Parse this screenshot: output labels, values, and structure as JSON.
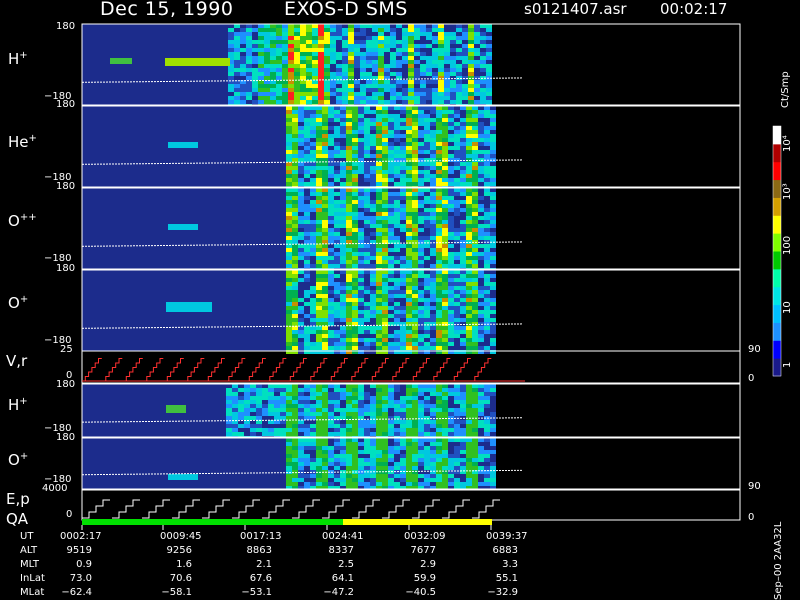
{
  "header": {
    "date": "Dec 15, 1990",
    "instrument": "EXOS-D SMS",
    "file": "s0121407.asr",
    "time": "00:02:17"
  },
  "colorbar": {
    "unit": "Ct/Smp",
    "ticks": [
      "10⁴",
      "10³",
      "100",
      "10",
      "1"
    ],
    "colors": [
      "#1a1a8a",
      "#0000ff",
      "#1e90ff",
      "#00bfff",
      "#00e5e5",
      "#00ffaa",
      "#00c800",
      "#7fff00",
      "#ffff00",
      "#d4a000",
      "#8b6914",
      "#ff0000",
      "#b00000",
      "#ffffff"
    ]
  },
  "panels": [
    {
      "label": "H",
      "sup": "+",
      "top_tick": "180",
      "bottom_tick": "−180"
    },
    {
      "label": "He",
      "sup": "+",
      "top_tick": "180",
      "bottom_tick": "−180"
    },
    {
      "label": "O",
      "sup": "++",
      "top_tick": "180",
      "bottom_tick": "−180"
    },
    {
      "label": "O",
      "sup": "+",
      "top_tick": "180",
      "bottom_tick": "−180"
    },
    {
      "label": "V,r",
      "sup": "",
      "top_tick": "25",
      "bottom_tick": "0",
      "right_top": "90",
      "right_bottom": "0"
    },
    {
      "label": "H",
      "sup": "+",
      "top_tick": "180",
      "bottom_tick": "−180"
    },
    {
      "label": "O",
      "sup": "+",
      "top_tick": "180",
      "bottom_tick": "−180"
    },
    {
      "label": "E,p",
      "label2": "QA",
      "top_tick": "4000",
      "bottom_tick": "0",
      "right_top": "90",
      "right_bottom": "0"
    }
  ],
  "footer_code": "Sep–00  2AA32L",
  "table": {
    "row_labels": [
      "UT",
      "ALT",
      "MLT",
      "InLat",
      "MLat"
    ],
    "columns": [
      [
        "0002:17",
        "9519",
        "0.9",
        "73.0",
        "−62.4"
      ],
      [
        "0009:45",
        "9256",
        "1.6",
        "70.6",
        "−58.1"
      ],
      [
        "0017:13",
        "8863",
        "2.1",
        "67.6",
        "−53.1"
      ],
      [
        "0024:41",
        "8337",
        "2.5",
        "64.1",
        "−47.2"
      ],
      [
        "0032:09",
        "7677",
        "2.9",
        "59.9",
        "−40.5"
      ],
      [
        "0039:37",
        "6883",
        "3.3",
        "55.1",
        "−32.9"
      ]
    ]
  },
  "chart_data": {
    "type": "heatmap",
    "title": "Dec 15, 1990   EXOS-D SMS",
    "x_ticks": [
      "0002:17",
      "0009:45",
      "0017:13",
      "0024:41",
      "0032:09",
      "0039:37"
    ],
    "colorbar_unit": "Ct/Smp",
    "colorbar_range": [
      1,
      10000
    ],
    "colorbar_scale": "log",
    "series": [
      {
        "name": "H+",
        "ylim": [
          -180,
          180
        ]
      },
      {
        "name": "He+",
        "ylim": [
          -180,
          180
        ]
      },
      {
        "name": "O++",
        "ylim": [
          -180,
          180
        ]
      },
      {
        "name": "O+",
        "ylim": [
          -180,
          180
        ]
      },
      {
        "name": "V,r",
        "ylim": [
          0,
          25
        ]
      },
      {
        "name": "H+",
        "ylim": [
          -180,
          180
        ]
      },
      {
        "name": "O+",
        "ylim": [
          -180,
          180
        ]
      },
      {
        "name": "E,p",
        "ylim": [
          0,
          4000
        ]
      }
    ],
    "qa_bar": [
      {
        "from": "0002:17",
        "to": "0024:41",
        "color": "#00e000"
      },
      {
        "from": "0024:41",
        "to": "0039:37",
        "color": "#ffff00"
      }
    ]
  }
}
